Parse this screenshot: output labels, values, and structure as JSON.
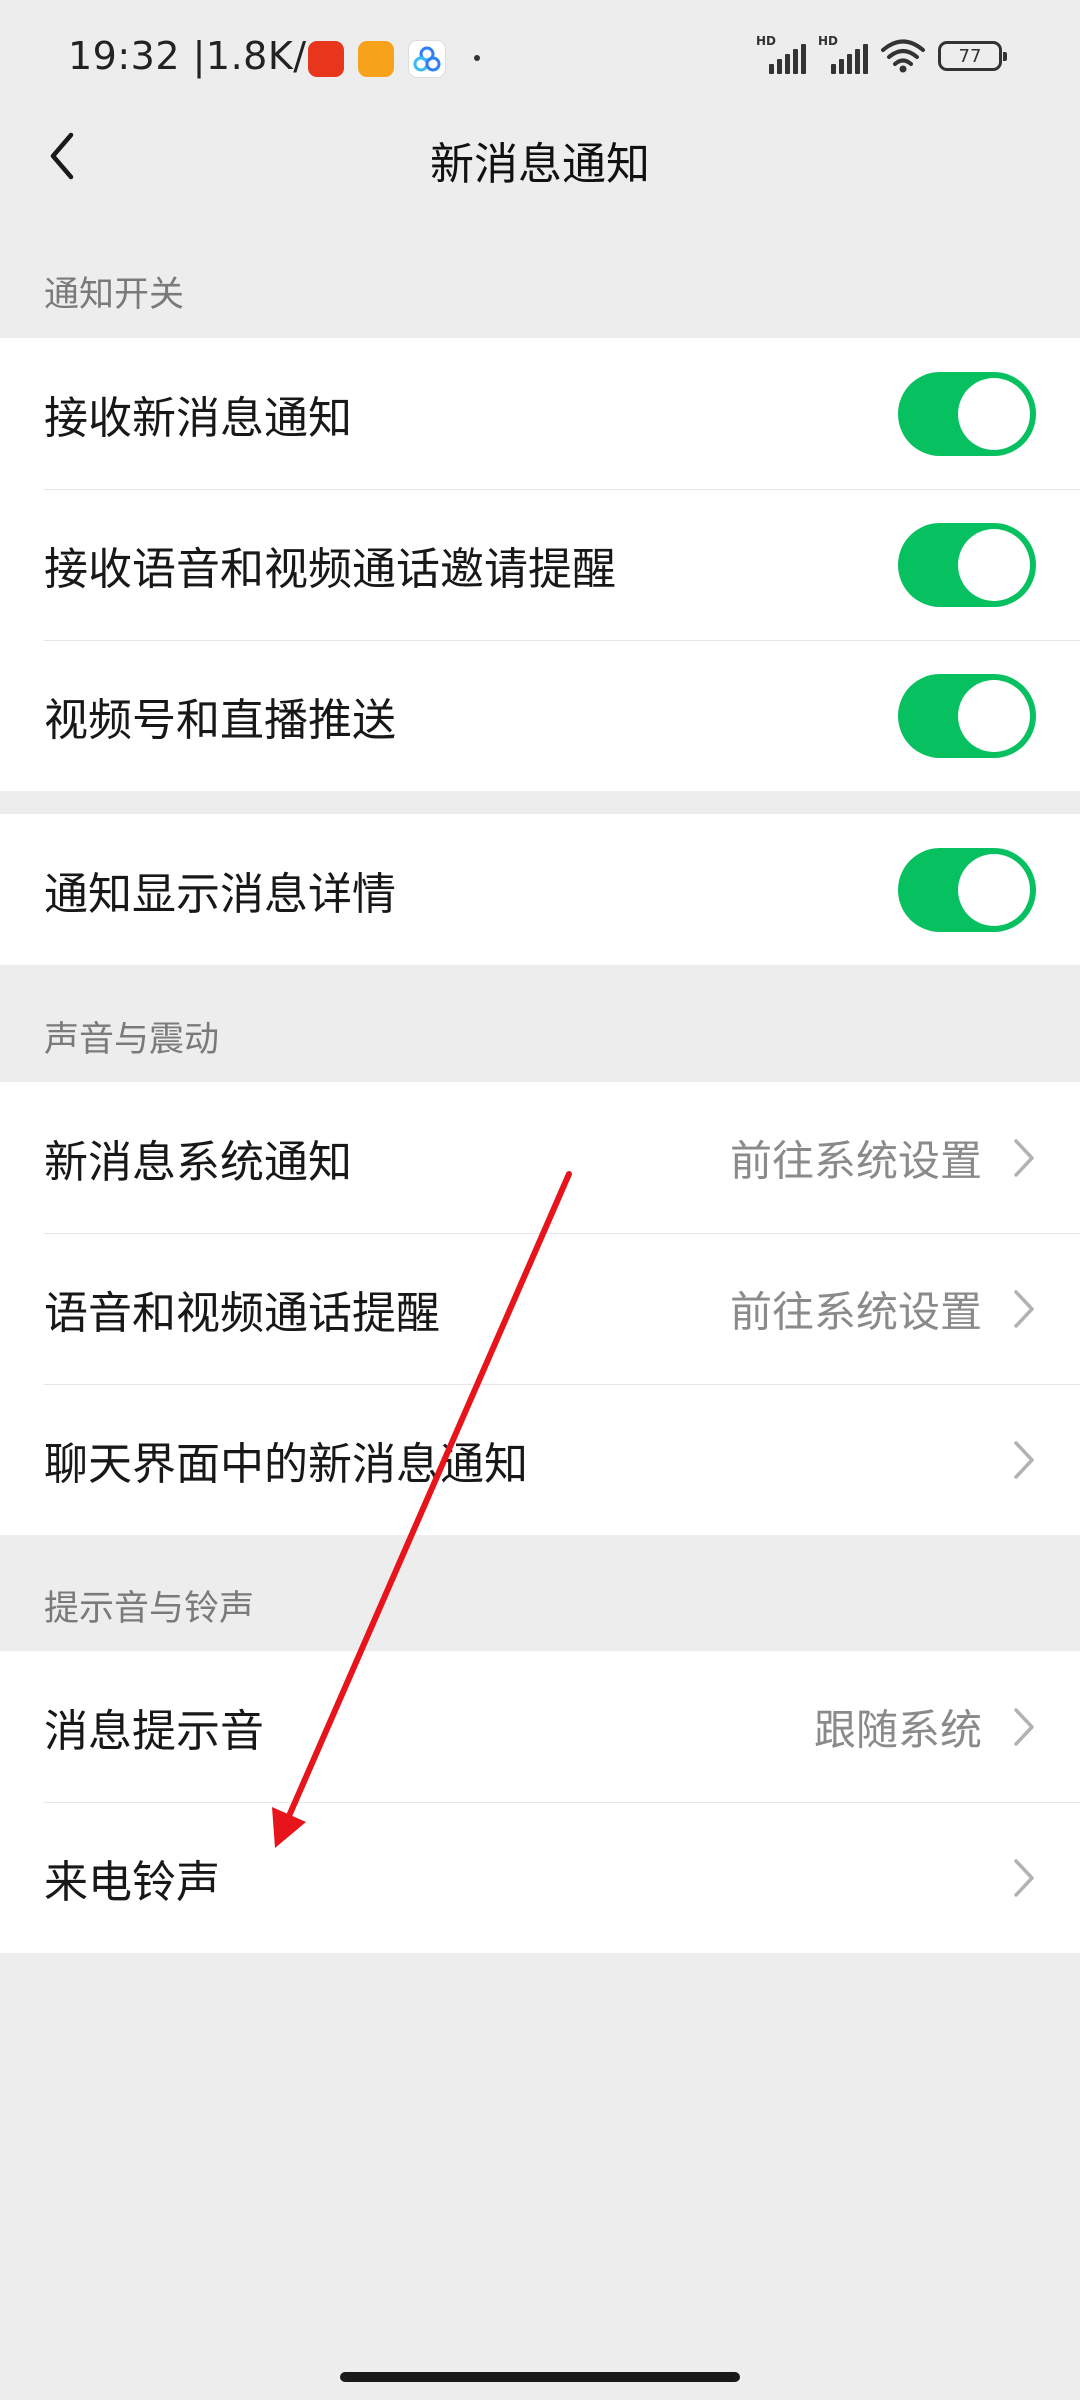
{
  "status_bar": {
    "time": "19:32",
    "network_speed": "1.8K/s",
    "separator": "|",
    "app_icons": [
      "taobao-icon",
      "notes-icon",
      "baidu-netdisk-icon"
    ],
    "signal_1_tag": "HD",
    "signal_2_tag": "HD",
    "battery": "77"
  },
  "header": {
    "title": "新消息通知"
  },
  "sections": {
    "notification_switch": {
      "label": "通知开关",
      "rows": [
        {
          "label": "接收新消息通知",
          "toggle": true
        },
        {
          "label": "接收语音和视频通话邀请提醒",
          "toggle": true
        },
        {
          "label": "视频号和直播推送",
          "toggle": true
        }
      ]
    },
    "notification_details": {
      "rows": [
        {
          "label": "通知显示消息详情",
          "toggle": true
        }
      ]
    },
    "sound_vibration": {
      "label": "声音与震动",
      "rows": [
        {
          "label": "新消息系统通知",
          "value": "前往系统设置"
        },
        {
          "label": "语音和视频通话提醒",
          "value": "前往系统设置"
        },
        {
          "label": "聊天界面中的新消息通知",
          "value": ""
        }
      ]
    },
    "ringtones": {
      "label": "提示音与铃声",
      "rows": [
        {
          "label": "消息提示音",
          "value": "跟随系统"
        },
        {
          "label": "来电铃声",
          "value": ""
        }
      ]
    }
  },
  "colors": {
    "background": "#ededed",
    "toggle_on": "#07c160",
    "annotation_arrow": "#e8141b"
  }
}
